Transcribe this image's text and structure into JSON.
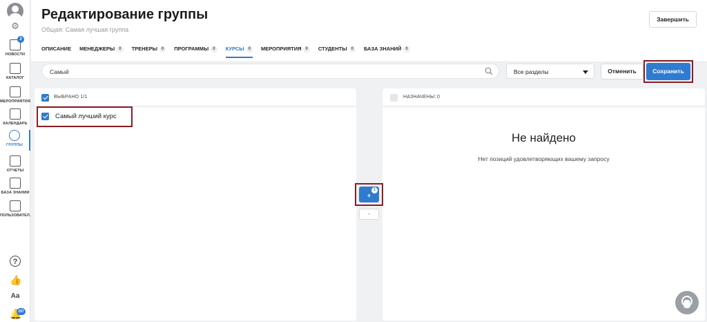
{
  "sidebar": {
    "news_badge": "2",
    "notifications_badge": "297",
    "items": [
      {
        "label": "НОВОСТИ"
      },
      {
        "label": "КАТАЛОГ"
      },
      {
        "label": "МЕРОПРИЯТИЯ"
      },
      {
        "label": "КАЛЕНДАРЬ"
      },
      {
        "label": "ГРУППЫ"
      },
      {
        "label": "ОТЧЕТЫ"
      },
      {
        "label": "БАЗА ЗНАНИЙ"
      },
      {
        "label": "ПОЛЬЗОВАТЕЛ..."
      }
    ]
  },
  "header": {
    "title": "Редактирование группы",
    "subtitle": "Общая: Самая лучшая группа",
    "finish_label": "Завершить"
  },
  "tabs": [
    {
      "label": "ОПИСАНИЕ",
      "count": ""
    },
    {
      "label": "МЕНЕДЖЕРЫ",
      "count": "0"
    },
    {
      "label": "ТРЕНЕРЫ",
      "count": "0"
    },
    {
      "label": "ПРОГРАММЫ",
      "count": "0"
    },
    {
      "label": "КУРСЫ",
      "count": "0"
    },
    {
      "label": "МЕРОПРИЯТИЯ",
      "count": "0"
    },
    {
      "label": "СТУДЕНТЫ",
      "count": "0"
    },
    {
      "label": "БАЗА ЗНАНИЙ",
      "count": "0"
    }
  ],
  "toolbar": {
    "search_value": "Самый",
    "section_select": "Все разделы",
    "cancel_label": "Отменить",
    "save_label": "Сохранить"
  },
  "left_panel": {
    "header_label": "ВЫБРАНО 1/1",
    "items": [
      {
        "label": "Самый лучший курс"
      }
    ]
  },
  "right_panel": {
    "header_label": "НАЗНАЧЕНЫ:",
    "count": "0",
    "empty_title": "Не найдено",
    "empty_subtitle": "Нет позиций удовлетворяющих вашему запросу"
  },
  "transfer": {
    "add_glyph": "+",
    "add_badge": "1",
    "remove_glyph": "-"
  },
  "colors": {
    "accent": "#2f7bd0",
    "highlight_outline": "#8a1c24"
  }
}
